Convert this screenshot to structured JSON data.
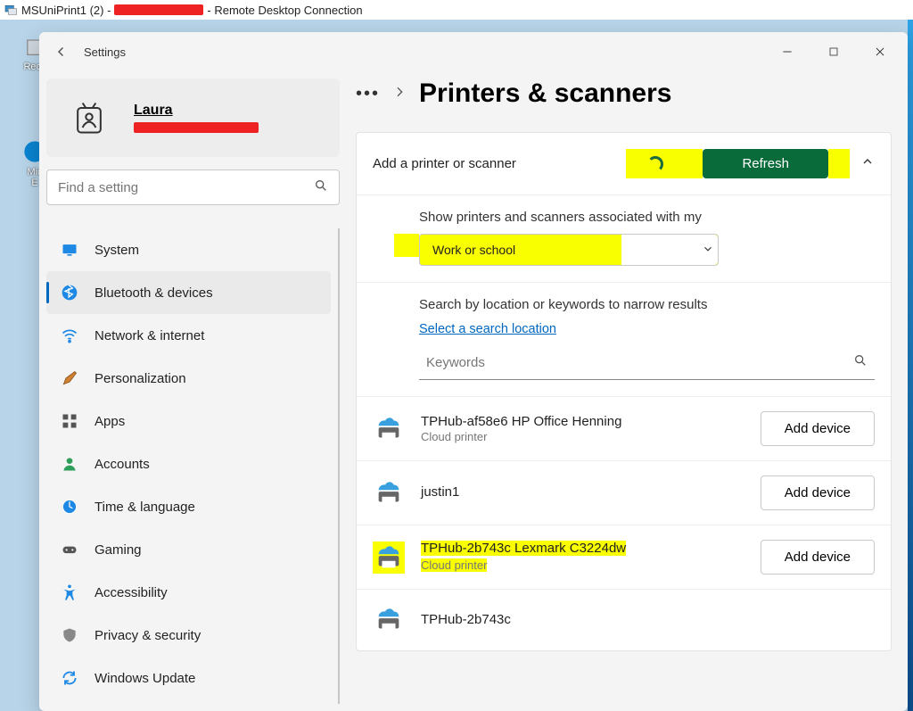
{
  "rdc_title_prefix": "MSUniPrint1 (2) - ",
  "rdc_title_suffix": " - Remote Desktop Connection",
  "desktop": {
    "recycle": "Recy",
    "edge_a": "Mic",
    "edge_b": "E"
  },
  "window": {
    "title": "Settings"
  },
  "profile": {
    "name": "Laura"
  },
  "search": {
    "placeholder": "Find a setting"
  },
  "sidebar": {
    "items": [
      {
        "label": "System"
      },
      {
        "label": "Bluetooth & devices"
      },
      {
        "label": "Network & internet"
      },
      {
        "label": "Personalization"
      },
      {
        "label": "Apps"
      },
      {
        "label": "Accounts"
      },
      {
        "label": "Time & language"
      },
      {
        "label": "Gaming"
      },
      {
        "label": "Accessibility"
      },
      {
        "label": "Privacy & security"
      },
      {
        "label": "Windows Update"
      }
    ]
  },
  "main": {
    "breadcrumb_more": "•••",
    "page_title": "Printers & scanners",
    "add_label": "Add a printer or scanner",
    "refresh_label": "Refresh",
    "assoc_label": "Show printers and scanners associated with my",
    "dropdown_value": "Work or school",
    "search_label": "Search by location or keywords to narrow results",
    "location_link": "Select a search location",
    "keywords_placeholder": "Keywords",
    "add_device_label": "Add device",
    "printers": [
      {
        "name": "TPHub-af58e6 HP Office Henning",
        "type": "Cloud printer"
      },
      {
        "name": "justin1",
        "type": ""
      },
      {
        "name": "TPHub-2b743c Lexmark C3224dw",
        "type": "Cloud printer"
      },
      {
        "name": "TPHub-2b743c",
        "type": ""
      }
    ]
  }
}
